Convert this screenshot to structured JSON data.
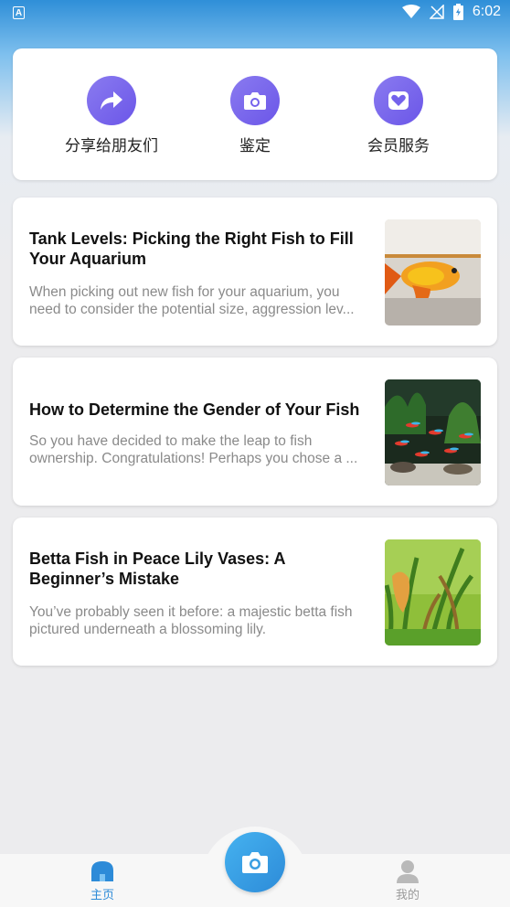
{
  "status_bar": {
    "time": "6:02",
    "notification_badge": "A"
  },
  "actions": [
    {
      "label": "分享给朋友们",
      "icon": "share-icon"
    },
    {
      "label": "鉴定",
      "icon": "camera-icon"
    },
    {
      "label": "会员服务",
      "icon": "heart-badge-icon"
    }
  ],
  "articles": [
    {
      "title": "Tank Levels: Picking the Right Fish to Fill Your Aquarium",
      "description": "When picking out new fish for your aquarium, you need to consider the potential size, aggression lev..."
    },
    {
      "title": "How to Determine the Gender of Your Fish",
      "description": "So you have decided to make the leap to fish ownership. Congratulations! Perhaps you chose a ..."
    },
    {
      "title": "Betta Fish in Peace Lily Vases: A Beginner’s Mistake",
      "description": "You’ve probably seen it before: a majestic betta fish pictured underneath a blossoming lily."
    }
  ],
  "bottom_nav": {
    "home_label": "主页",
    "profile_label": "我的",
    "active_color": "#2d8bd8",
    "inactive_color": "#9a9a9a"
  }
}
